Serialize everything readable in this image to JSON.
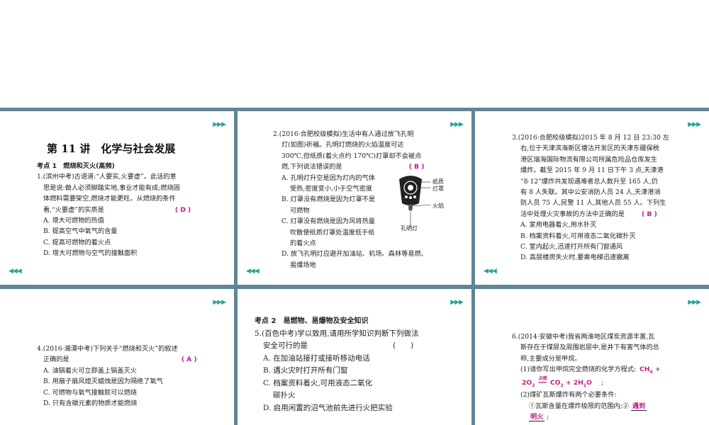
{
  "slides": {
    "s1": {
      "title": "第 11 讲　化学与社会发展",
      "kd_label": "考点 1　燃烧和灭火(高频)",
      "lines": [
        "1.(滨州中考)古语道:“人要实,火要虚”。此话的意",
        "思是说:做人必须脚踏实地,事业才能有成;燃烧固",
        "体燃料需要架空,燃烧才能更旺。从燃烧的条件"
      ],
      "q_line": "看,“火要虚”的实质是",
      "answer": "( D )",
      "options": [
        "A. 增大可燃物的热值",
        "B. 提高空气中氧气的含量",
        "C. 提高可燃物的着火点",
        "D. 增大可燃物与空气的接触面积"
      ]
    },
    "s2": {
      "lines": [
        "2.(2016·合肥校级模拟)生活中有人通过放飞孔明",
        "灯(如图)祈福。孔明灯燃烧的火焰温度可达",
        "300℃,但纸质(着火点约 170℃)灯罩却不会被点"
      ],
      "q_line": "燃,下列说法错误的是",
      "answer": "( B )",
      "options": [
        "A. 孔明灯升空是因为灯内的气体",
        "受热,密度变小,小于空气密度",
        "B. 灯罩没有燃烧是因为灯罩不是",
        "可燃物",
        "C. 灯罩没有燃烧是因为风将热量",
        "吹散使纸质灯罩处温度低于纸",
        "的着火点",
        "D. 放飞孔明灯应避开加油站、机场、森林等易燃、",
        "易爆场地"
      ],
      "fig": {
        "label_paper": "纸质",
        "label_shade": "灯罩",
        "label_flame": "火焰",
        "label_caption": "孔明灯"
      }
    },
    "s3": {
      "lines": [
        "3.(2016·合肥校级模拟)2015 年 8 月 12 日 23:30 左",
        "右,位于天津滨海新区塘沽开发区的天津东疆保税",
        "港区瑞海国际物流有限公司所属危险品仓库发生",
        "爆炸。截至 2015 年 9 月 11 日下午 3 点,天津港",
        "“8·12”爆炸共发现遇难者总人数升至 165 人,仍",
        "有 8 人失联。其中公安消防人员 24 人,天津港消",
        "防人员 75 人,民警 11 人,其他人员 55 人。下列生"
      ],
      "q_line": "活中处理火灾事故的方法中正确的是",
      "answer": "( B )",
      "options": [
        "A. 家用电器着火,用水扑灭",
        "B. 档案资料着火,可用液态二氧化碳扑灭",
        "C. 室内起火,迅速打开所有门窗通风",
        "D. 高层楼房失火时,要乘电梯迅速撤离"
      ]
    },
    "s4": {
      "lines": [
        "4.(2016·湘潭中考)下列关于“燃烧和灭火”的叙述"
      ],
      "q_line": "正确的是",
      "answer": "( A )",
      "options": [
        "A. 油锅着火可立即盖上锅盖灭火",
        "B. 用扇子扇风熄灭蜡烛是因为隔绝了氧气",
        "C. 可燃物与氧气接触就可以燃烧",
        "D. 只有含碳元素的物质才能燃烧"
      ]
    },
    "s5": {
      "kd_label": "考点 2　易燃物、易爆物及安全知识",
      "lines": [
        "5.(百色中考)学以致用,请用所学知识判断下列做法"
      ],
      "q_line": "安全可行的是",
      "answer": "(　　)",
      "options": [
        "A. 在加油站接打或接听移动电话",
        "B. 遇火灾时打开所有门窗",
        "C. 档案资料着火,可用液态二氧化",
        "碳扑火",
        "D. 启用闲置的沼气池前先进行火把实验"
      ]
    },
    "s6": {
      "lines": [
        "6.(2014·安徽中考)我省两淮地区煤炭资源丰富,瓦",
        "斯存在于煤层及周围岩层中,是井下有害气体的总",
        "称,主要成分是甲烷。"
      ],
      "sub1": "(1)请你写出甲烷完全燃烧的化学方程式:",
      "eq_a": "CH",
      "eq_a_sub": "4",
      "eq_plus": "+",
      "eq_b": "2O",
      "eq_b_sub": "2",
      "eq_cond": "点燃",
      "eq_c": "CO",
      "eq_c_sub": "2",
      "eq_d": "+ 2H",
      "eq_d_sub": "2",
      "eq_e": "O",
      "eq_end": ";",
      "sub2": "(2)煤矿瓦斯爆炸有两个必要条件:",
      "sub2a": "①瓦斯含量在爆炸极限的范围内;②",
      "fill_a": "遇到",
      "fill_b": "明火",
      "sub2_end": ";"
    }
  }
}
